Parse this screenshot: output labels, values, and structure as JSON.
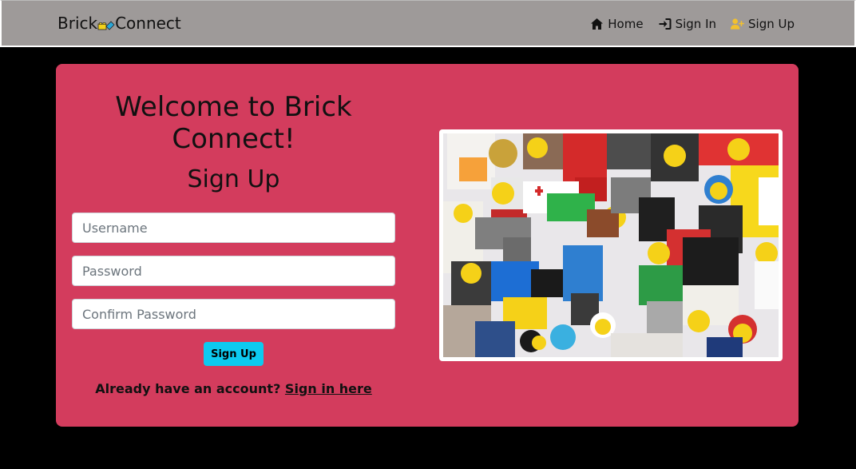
{
  "nav": {
    "brand_left": "Brick",
    "brand_right": "Connect",
    "links": [
      {
        "label": "Home",
        "icon": "home-icon"
      },
      {
        "label": "Sign In",
        "icon": "sign-in-icon"
      },
      {
        "label": "Sign Up",
        "icon": "user-plus-icon"
      }
    ]
  },
  "card": {
    "title": "Welcome to Brick Connect!",
    "subtitle": "Sign Up",
    "username_placeholder": "Username",
    "password_placeholder": "Password",
    "confirm_placeholder": "Confirm Password",
    "submit_label": "Sign Up",
    "signin_prompt": "Already have an account?",
    "signin_link": "Sign in here"
  },
  "colors": {
    "navbar": "#9e9a99",
    "card": "#d33c5d",
    "button": "#0dcaf0",
    "signup_icon": "#f2c12e"
  }
}
